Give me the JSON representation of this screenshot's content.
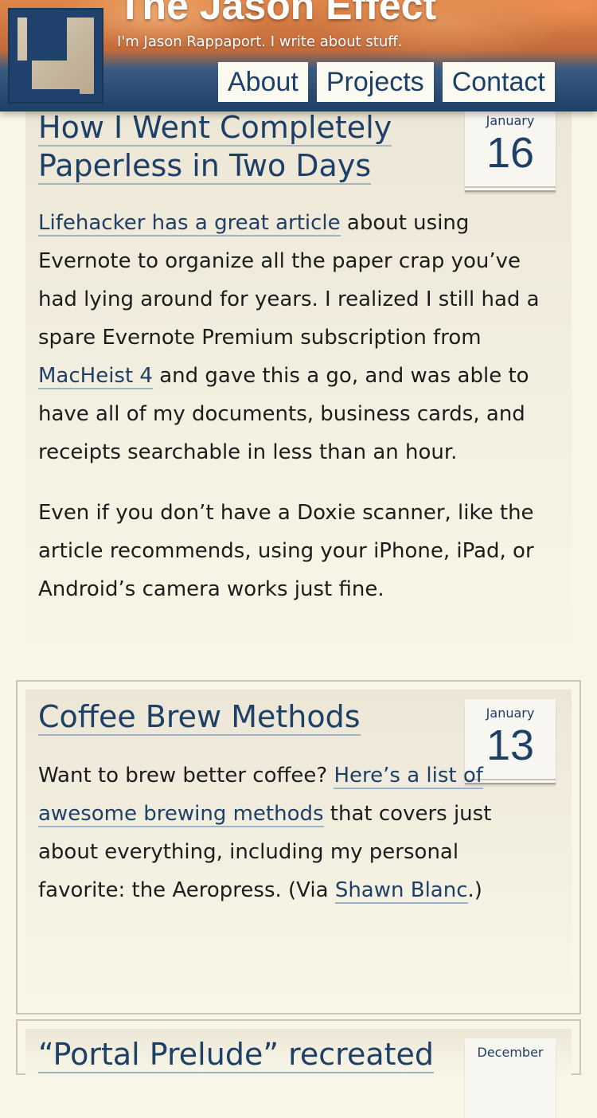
{
  "site": {
    "title": "The Jason Effect",
    "tagline": "I'm Jason Rappaport. I write about stuff.",
    "logo_letter": "J"
  },
  "nav": [
    "About",
    "Projects",
    "Contact"
  ],
  "posts": [
    {
      "title": "How I Went Completely Paperless in Two Days",
      "date": {
        "month": "January",
        "day": "16"
      },
      "paragraphs": [
        {
          "link1": "Lifehacker has a great article",
          "text1": " about using Evernote to organize all the paper crap you’ve had lying around for years. I realized I still had a spare Evernote Premium subscription from ",
          "link2": "MacHeist 4",
          "text2": " and gave this a go, and was able to have all of my documents, business cards, and receipts searchable in less than an hour."
        },
        {
          "text": "Even if you don’t have a Doxie scanner, like the article recommends, using your iPhone, iPad, or Android’s camera works just fine."
        }
      ]
    },
    {
      "title": "Coffee Brew Methods",
      "date": {
        "month": "January",
        "day": "13"
      },
      "paragraphs": [
        {
          "text1": "Want to brew better coffee? ",
          "link1": "Here’s a list of awesome brewing methods",
          "text2": " that covers just about everything, including my personal favorite: the Aeropress. (Via ",
          "link2": "Shawn Blanc",
          "text3": ".)"
        }
      ]
    },
    {
      "title": "“Portal Prelude” recreated",
      "date": {
        "month": "December"
      }
    }
  ]
}
